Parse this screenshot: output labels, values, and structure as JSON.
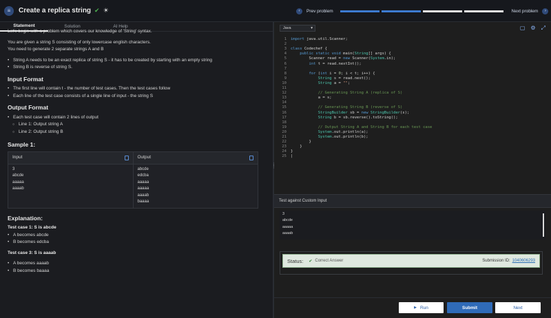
{
  "header": {
    "title": "Create a replica string",
    "prev_label": "Prev problem",
    "next_label": "Next problem",
    "progress": [
      1,
      1,
      0,
      0,
      0
    ],
    "accent_color": "#3d7bd1"
  },
  "tabs": [
    "Statement",
    "Solution",
    "AI Help"
  ],
  "statement": {
    "intro_cut": "Let's begin with a problem which covers our knowledge of 'String' syntax.",
    "p1": "You are given a string S consisting of only lowercase english characters.",
    "p2": "You need to generate 2 separate strings A and B",
    "b1": "String A needs to be an exact replica of string S - it has to be created by starting with an empty string",
    "b2": "String B is reverse of string S.",
    "input_format_title": "Input Format",
    "if1": "The first line will contain t - the number of test cases. Then the test cases follow",
    "if2": "Each line of the test case consists of a single line of input - the string S",
    "output_format_title": "Output Format",
    "of1": "Each test case will contain 2 lines of output",
    "of2": "Line 1: Output string A",
    "of3": "Line 2: Output string B",
    "sample_title": "Sample 1:",
    "sample_input_label": "Input",
    "sample_output_label": "Output",
    "sample_input": [
      "3",
      "abcde",
      "aaaaa",
      "aaaab"
    ],
    "sample_output": [
      "abcde",
      "edcba",
      "aaaaa",
      "aaaaa",
      "aaaab",
      "baaaa"
    ],
    "explanation_title": "Explanation:",
    "tc1": "Test case 1: S is abcde",
    "tc1a": "A becomes abcde",
    "tc1b": "B becomes edcba",
    "tc3": "Test case 3: S is aaaab",
    "tc3a": "A becomes aaaab",
    "tc3b": "B becomes baaaa"
  },
  "editor": {
    "language": "Java",
    "line_numbers": [
      "1",
      "2",
      "3",
      "4",
      "5",
      "6",
      "7",
      "8",
      "9",
      "10",
      "11",
      "12",
      "13",
      "14",
      "15",
      "16",
      "17",
      "18",
      "19",
      "20",
      "21",
      "22",
      "23",
      "24",
      "25"
    ]
  },
  "custom": {
    "label": "Test against Custom Input",
    "lines": [
      "3",
      "abcde",
      "aaaaa",
      "aaaab"
    ]
  },
  "status": {
    "label": "Status:",
    "result": "Correct Answer",
    "submission_label": "Submission ID:",
    "submission_id": "1040606293",
    "status_color": "#2e7d32"
  },
  "buttons": {
    "run": "Run",
    "submit": "Submit",
    "next": "Next"
  }
}
